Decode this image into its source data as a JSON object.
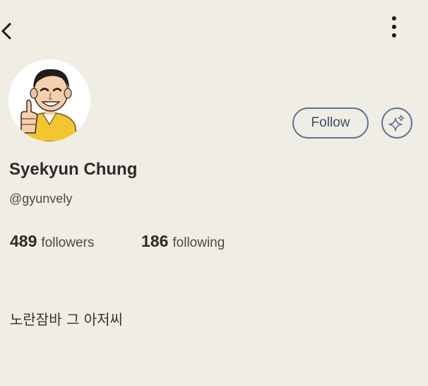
{
  "profile": {
    "name": "Syekyun Chung",
    "handle": "@gyunvely",
    "bio": "노란잠바 그 아저씨"
  },
  "stats": {
    "followers": {
      "count": "489",
      "label": "followers"
    },
    "following": {
      "count": "186",
      "label": "following"
    }
  },
  "actions": {
    "follow_label": "Follow"
  },
  "icons": {
    "back": "chevron-left-icon",
    "more": "more-vertical-icon",
    "sparkle": "sparkle-icon"
  },
  "colors": {
    "background": "#efede4",
    "accent": "#5d7294",
    "text": "#2b2b2b"
  }
}
